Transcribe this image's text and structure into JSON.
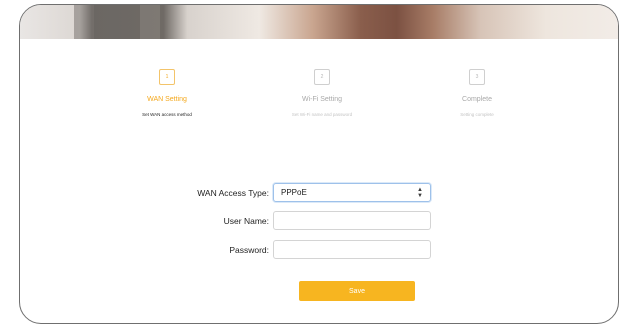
{
  "wizard": {
    "steps": [
      {
        "number": "1",
        "title": "WAN Setting",
        "subtitle": "Set WAN access method",
        "active": true
      },
      {
        "number": "2",
        "title": "Wi-Fi Setting",
        "subtitle": "Set Wi-Fi name and password",
        "active": false
      },
      {
        "number": "3",
        "title": "Complete",
        "subtitle": "Setting complete",
        "active": false
      }
    ]
  },
  "form": {
    "wan_access_type_label": "WAN Access Type:",
    "wan_access_type_value": "PPPoE",
    "user_name_label": "User Name:",
    "user_name_value": "",
    "password_label": "Password:",
    "password_value": "",
    "save_label": "Save"
  },
  "colors": {
    "accent": "#f7b520",
    "active_step": "#f4a81d"
  }
}
